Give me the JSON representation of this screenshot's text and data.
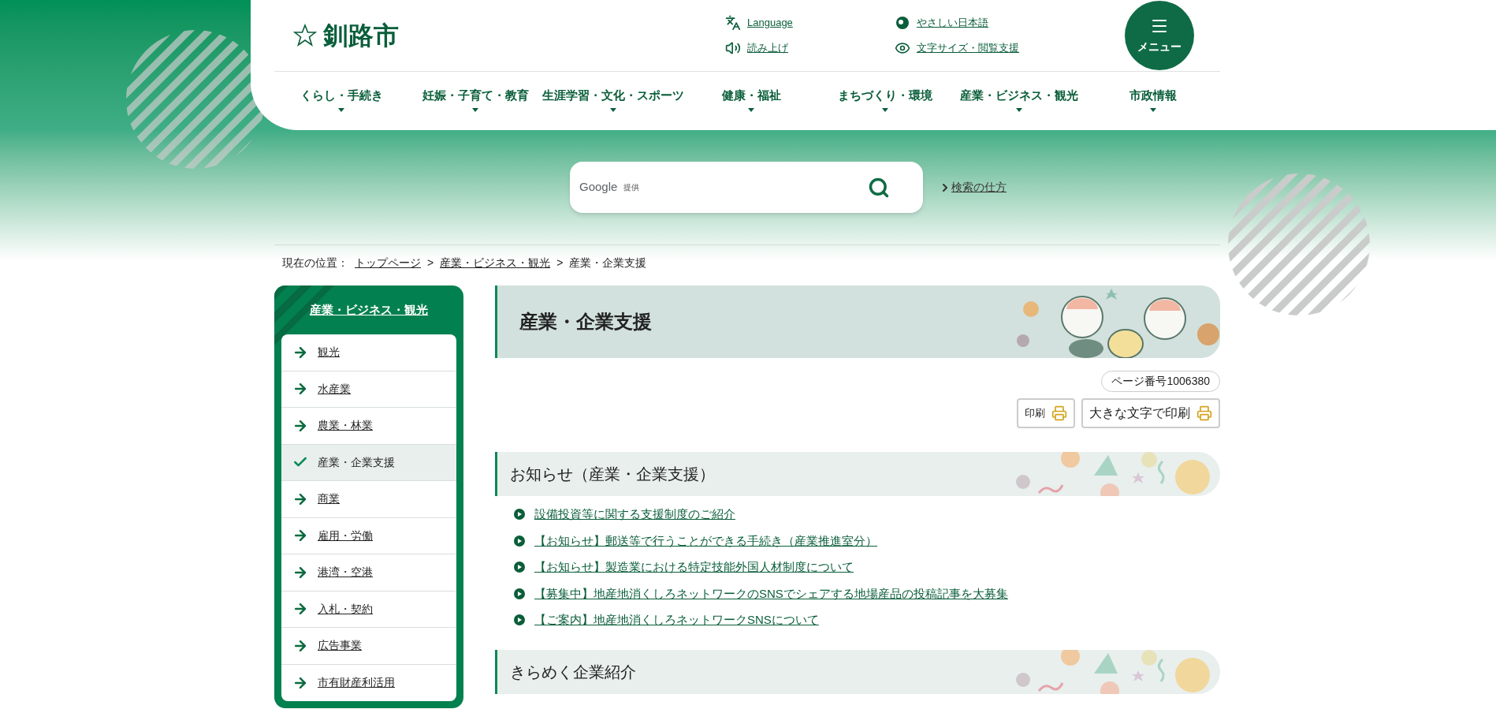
{
  "header": {
    "logo": "釧路市",
    "menu_button": "メニュー",
    "utility_links": [
      {
        "kind": "language",
        "label": "Language"
      },
      {
        "kind": "easy",
        "label": "やさしい日本語"
      },
      {
        "kind": "speaker",
        "label": "読み上げ"
      },
      {
        "kind": "eye",
        "label": "文字サイズ・閲覧支援"
      }
    ]
  },
  "nav": [
    "くらし・手続き",
    "妊娠・子育て・教育",
    "生涯学習・文化・スポーツ",
    "健康・福祉",
    "まちづくり・環境",
    "産業・ビジネス・観光",
    "市政情報"
  ],
  "search": {
    "provider": "Google",
    "provider_note": "提供",
    "help_link": "検索の仕方"
  },
  "breadcrumb": {
    "label": "現在の位置：",
    "items": [
      {
        "text": "トップページ",
        "kind": "link"
      },
      {
        "text": ">",
        "kind": "separator"
      },
      {
        "text": "産業・ビジネス・観光",
        "kind": "link"
      },
      {
        "text": ">",
        "kind": "separator"
      },
      {
        "text": "産業・企業支援",
        "kind": "current"
      }
    ]
  },
  "sidebar": {
    "title": "産業・ビジネス・観光",
    "items": [
      {
        "label": "観光",
        "selected": false
      },
      {
        "label": "水産業",
        "selected": false
      },
      {
        "label": "農業・林業",
        "selected": false
      },
      {
        "label": "産業・企業支援",
        "selected": true
      },
      {
        "label": "商業",
        "selected": false
      },
      {
        "label": "雇用・労働",
        "selected": false
      },
      {
        "label": "港湾・空港",
        "selected": false
      },
      {
        "label": "入札・契約",
        "selected": false
      },
      {
        "label": "広告事業",
        "selected": false
      },
      {
        "label": "市有財産利活用",
        "selected": false
      }
    ]
  },
  "main": {
    "title": "産業・企業支援",
    "page_number": "ページ番号1006380",
    "print_buttons": [
      "印刷",
      "大きな文字で印刷"
    ],
    "sections": [
      {
        "title": "お知らせ（産業・企業支援）",
        "items": [
          "設備投資等に関する支援制度のご紹介",
          "【お知らせ】郵送等で行うことができる手続き（産業推進室分）",
          "【お知らせ】製造業における特定技能外国人材制度について",
          "【募集中】地産地消くしろネットワークのSNSでシェアする地場産品の投稿記事を大募集",
          "【ご案内】地産地消くしろネットワークSNSについて"
        ]
      },
      {
        "title": "きらめく企業紹介"
      }
    ]
  }
}
